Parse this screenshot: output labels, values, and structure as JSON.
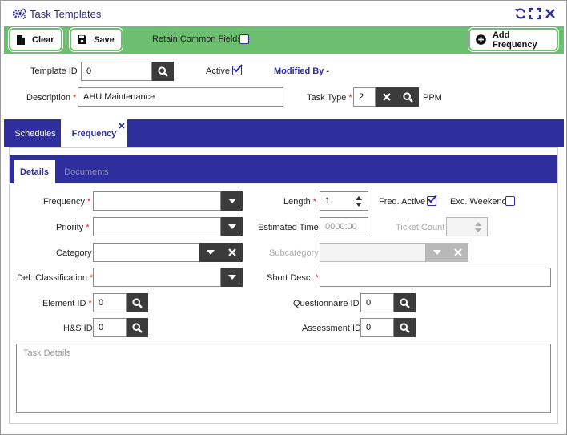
{
  "window": {
    "title": "Task Templates"
  },
  "toolbar": {
    "clear_label": "Clear",
    "save_label": "Save",
    "retain_label": "Retain Common Fields",
    "add_frequency_label": "Add Frequency",
    "accent_color": "#6cbf6f"
  },
  "header": {
    "template_id_label": "Template ID",
    "template_id_value": "0",
    "active_label": "Active",
    "active_checked": true,
    "modified_by_label": "Modified By -",
    "description_label": "Description",
    "description_value": "AHU Maintenance",
    "task_type_label": "Task Type",
    "task_type_value": "2",
    "task_type_name": "PPM"
  },
  "tabs": [
    {
      "label": "Schedules",
      "active": false
    },
    {
      "label": "Frequency",
      "active": true
    }
  ],
  "subtabs": [
    {
      "label": "Details",
      "active": true
    },
    {
      "label": "Documents",
      "active": false
    }
  ],
  "form": {
    "frequency_label": "Frequency",
    "length_label": "Length",
    "length_value": "1",
    "freq_active_label": "Freq. Active",
    "freq_active_checked": true,
    "exc_weekend_label": "Exc. Weekend",
    "exc_weekend_checked": false,
    "priority_label": "Priority",
    "estimated_time_label": "Estimated Time",
    "estimated_time_placeholder": "0000:00",
    "ticket_count_label": "Ticket Count",
    "category_label": "Category",
    "subcategory_label": "Subcategory",
    "def_classification_label": "Def. Classification",
    "short_desc_label": "Short Desc.",
    "element_id_label": "Element ID",
    "element_id_value": "0",
    "questionnaire_id_label": "Questionnaire ID",
    "questionnaire_id_value": "0",
    "hs_id_label": "H&S ID",
    "hs_id_value": "0",
    "assessment_id_label": "Assessment ID",
    "assessment_id_value": "0",
    "task_details_placeholder": "Task Details"
  },
  "colors": {
    "brand_blue": "#2e2e9c",
    "required": "#d9242a"
  }
}
